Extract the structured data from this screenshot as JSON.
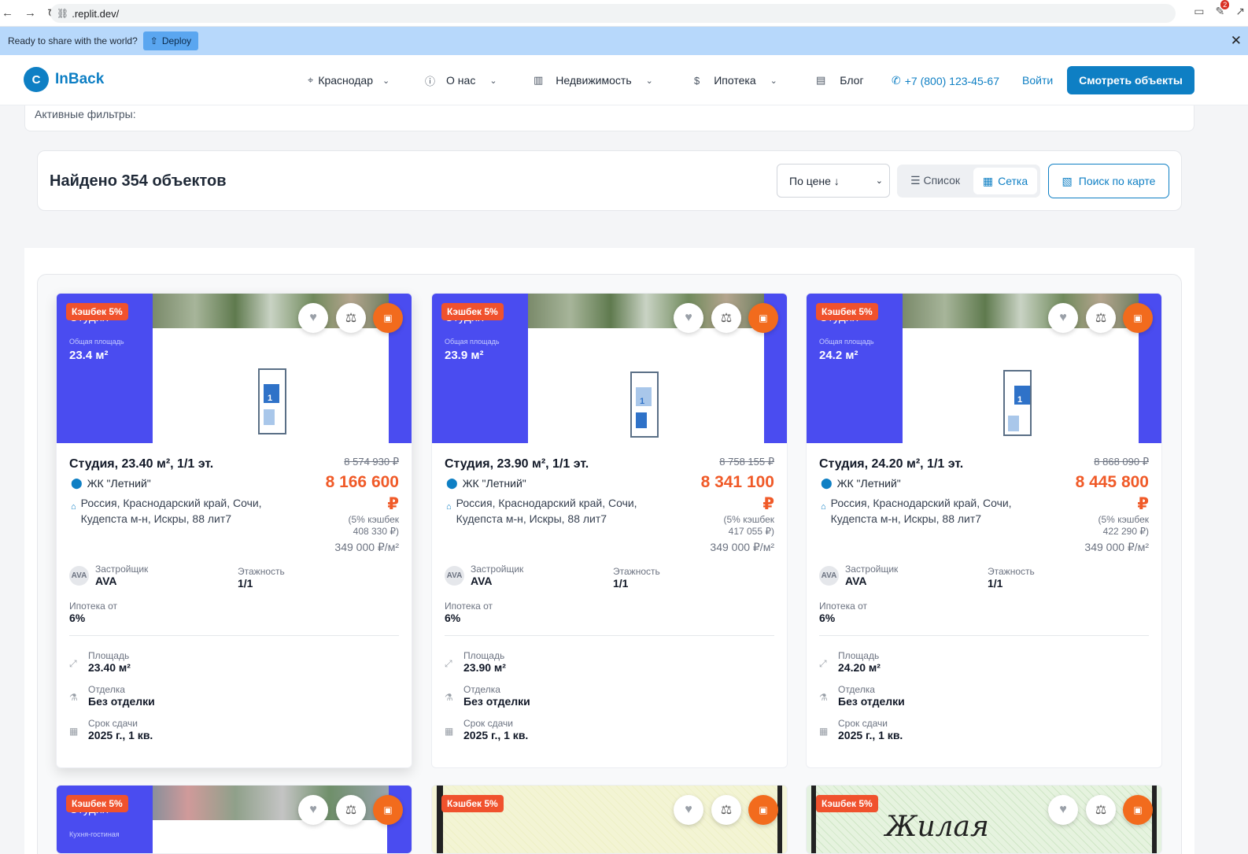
{
  "browser": {
    "url": ".replit.dev/",
    "notif_count": "2"
  },
  "banner": {
    "text": "Ready to share with the world?",
    "deploy_label": "Deploy"
  },
  "header": {
    "logo_letter": "C",
    "logo_name": "InBack",
    "city": "Краснодар",
    "about": "О нас",
    "realty": "Недвижимость",
    "mortgage": "Ипотека",
    "blog": "Блог",
    "phone": "+7 (800) 123-45-67",
    "login": "Войти",
    "cta": "Смотреть объекты"
  },
  "filters": {
    "label": "Активные фильтры:"
  },
  "results": {
    "count_text": "Найдено 354 объектов",
    "sort_label": "По цене ↓",
    "view_list": "Список",
    "view_grid": "Сетка",
    "map_search": "Поиск по карте"
  },
  "labels": {
    "developer": "Застройщик",
    "floors": "Этажность",
    "mortgage_from": "Ипотека от",
    "area": "Площадь",
    "finish": "Отделка",
    "deadline": "Срок сдачи",
    "total_area": "Общая площадь",
    "studio": "Студия",
    "kitchen_living": "Кухня-гостиная"
  },
  "cards": [
    {
      "cashback_badge": "Кэшбек 5%",
      "photo_area": "23.4 м²",
      "title": "Студия, 23.40 м², 1/1 эт.",
      "complex": "ЖК \"Летний\"",
      "address": "Россия, Краснодарский край, Сочи, Кудепста м-н, Искры, 88 лит7",
      "old_price": "8 574 930 ₽",
      "new_price": "8 166 600",
      "currency": "₽",
      "cashback_note": "(5% кэшбек",
      "cashback_amount": "408 330 ₽)",
      "price_per_m2": "349 000 ₽/м²",
      "developer": "AVA",
      "developer_avatar": "AVA",
      "floors": "1/1",
      "mortgage": "6%",
      "area": "23.40 м²",
      "finish": "Без отделки",
      "deadline": "2025 г., 1 кв."
    },
    {
      "cashback_badge": "Кэшбек 5%",
      "photo_area": "23.9 м²",
      "title": "Студия, 23.90 м², 1/1 эт.",
      "complex": "ЖК \"Летний\"",
      "address": "Россия, Краснодарский край, Сочи, Кудепста м-н, Искры, 88 лит7",
      "old_price": "8 758 155 ₽",
      "new_price": "8 341 100",
      "currency": "₽",
      "cashback_note": "(5% кэшбек",
      "cashback_amount": "417 055 ₽)",
      "price_per_m2": "349 000 ₽/м²",
      "developer": "AVA",
      "developer_avatar": "AVA",
      "floors": "1/1",
      "mortgage": "6%",
      "area": "23.90 м²",
      "finish": "Без отделки",
      "deadline": "2025 г., 1 кв."
    },
    {
      "cashback_badge": "Кэшбек 5%",
      "photo_area": "24.2 м²",
      "title": "Студия, 24.20 м², 1/1 эт.",
      "complex": "ЖК \"Летний\"",
      "address": "Россия, Краснодарский край, Сочи, Кудепста м-н, Искры, 88 лит7",
      "old_price": "8 868 090 ₽",
      "new_price": "8 445 800",
      "currency": "₽",
      "cashback_note": "(5% кэшбек",
      "cashback_amount": "422 290 ₽)",
      "price_per_m2": "349 000 ₽/м²",
      "developer": "AVA",
      "developer_avatar": "AVA",
      "floors": "1/1",
      "mortgage": "6%",
      "area": "24.20 м²",
      "finish": "Без отделки",
      "deadline": "2025 г., 1 кв."
    }
  ],
  "row2": {
    "badge": "Кэшбек 5%",
    "plan_word": "Жилая"
  }
}
